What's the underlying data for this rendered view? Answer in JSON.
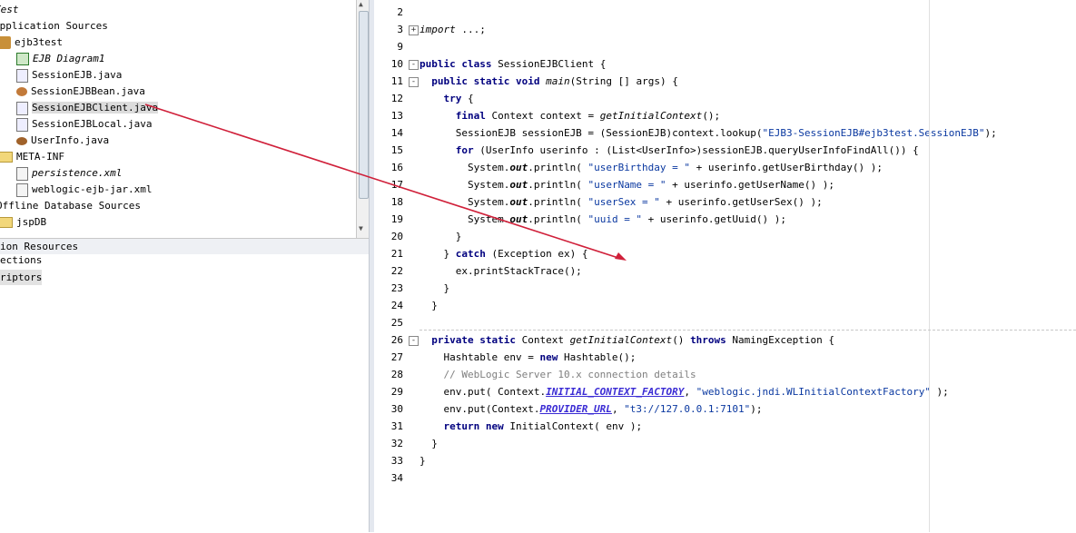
{
  "navigator": {
    "items": [
      {
        "label": "Test",
        "italic": true
      },
      {
        "label": "Application Sources"
      },
      {
        "label": "ejb3test"
      },
      {
        "label": "EJB Diagram1",
        "italic": true
      },
      {
        "label": "SessionEJB.java"
      },
      {
        "label": "SessionEJBBean.java"
      },
      {
        "label": "SessionEJBClient.java"
      },
      {
        "label": "SessionEJBLocal.java"
      },
      {
        "label": "UserInfo.java"
      },
      {
        "label": "META-INF"
      },
      {
        "label": "persistence.xml",
        "italic": true
      },
      {
        "label": "weblogic-ejb-jar.xml"
      },
      {
        "label": "Offline Database Sources"
      },
      {
        "label": "jspDB"
      }
    ],
    "lower": [
      "ion Resources",
      "ections",
      "riptors"
    ]
  },
  "editor": {
    "line_numbers": [
      "2",
      "3",
      "9",
      "10",
      "11",
      "12",
      "13",
      "14",
      "15",
      "16",
      "17",
      "18",
      "19",
      "20",
      "21",
      "22",
      "23",
      "24",
      "25",
      "26",
      "27",
      "28",
      "29",
      "30",
      "31",
      "32",
      "33",
      "34"
    ],
    "lines": [
      "",
      "import ...;",
      "",
      "public class SessionEJBClient {",
      "  public static void main(String [] args) {",
      "    try {",
      "      final Context context = getInitialContext();",
      "      SessionEJB sessionEJB = (SessionEJB)context.lookup(\"EJB3-SessionEJB#ejb3test.SessionEJB\");",
      "      for (UserInfo userinfo : (List<UserInfo>)sessionEJB.queryUserInfoFindAll()) {",
      "        System.out.println( \"userBirthday = \" + userinfo.getUserBirthday() );",
      "        System.out.println( \"userName = \" + userinfo.getUserName() );",
      "        System.out.println( \"userSex = \" + userinfo.getUserSex() );",
      "        System.out.println( \"uuid = \" + userinfo.getUuid() );",
      "      }",
      "    } catch (Exception ex) {",
      "      ex.printStackTrace();",
      "    }",
      "  }",
      "",
      "  private static Context getInitialContext() throws NamingException {",
      "    Hashtable env = new Hashtable();",
      "    // WebLogic Server 10.x connection details",
      "    env.put( Context.INITIAL_CONTEXT_FACTORY, \"weblogic.jndi.WLInitialContextFactory\" );",
      "    env.put(Context.PROVIDER_URL, \"t3://127.0.0.1:7101\");",
      "    return new InitialContext( env );",
      "  }",
      "}",
      ""
    ]
  },
  "colors": {
    "arrow": "#d0203a",
    "keyword": "#00007f",
    "string": "#0a38a0",
    "comment": "#7f7f7f"
  }
}
